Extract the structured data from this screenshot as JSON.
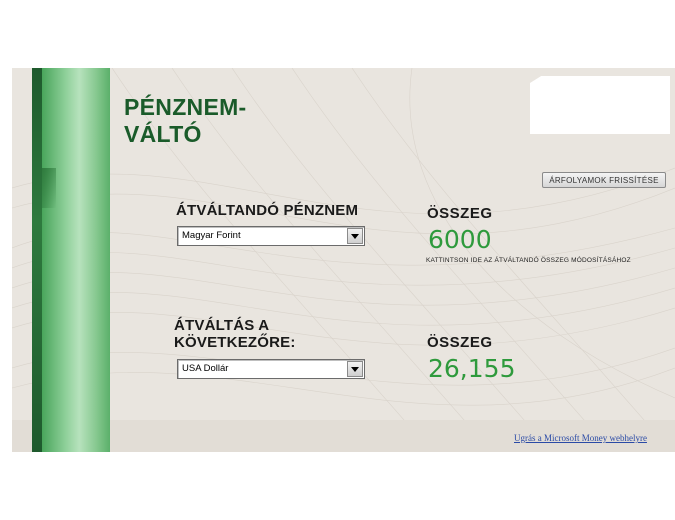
{
  "app": {
    "title_line1": "PÉNZNEM-",
    "title_line2": "VÁLTÓ"
  },
  "toolbar": {
    "refresh_label": "ÁRFOLYAMOK FRISSÍTÉSE"
  },
  "source": {
    "label": "ÁTVÁLTANDÓ PÉNZNEM",
    "selected_currency": "Magyar Forint",
    "amount_label": "ÖSSZEG",
    "amount_value": "6000",
    "hint": "KATTINTSON IDE AZ ÁTVÁLTANDÓ ÖSSZEG MÓDOSÍTÁSÁHOZ"
  },
  "target": {
    "label_line1": "ÁTVÁLTÁS A",
    "label_line2": "KÖVETKEZŐRE:",
    "selected_currency": "USA Dollár",
    "amount_label": "ÖSSZEG",
    "amount_value": "26,155"
  },
  "footer": {
    "link_text": "Ugrás a Microsoft Money webhelyre"
  },
  "colors": {
    "title_green": "#1a5b2a",
    "amount_green": "#2e9a3c",
    "panel_bg": "#e9e5df",
    "link_blue": "#2a4aa6"
  }
}
